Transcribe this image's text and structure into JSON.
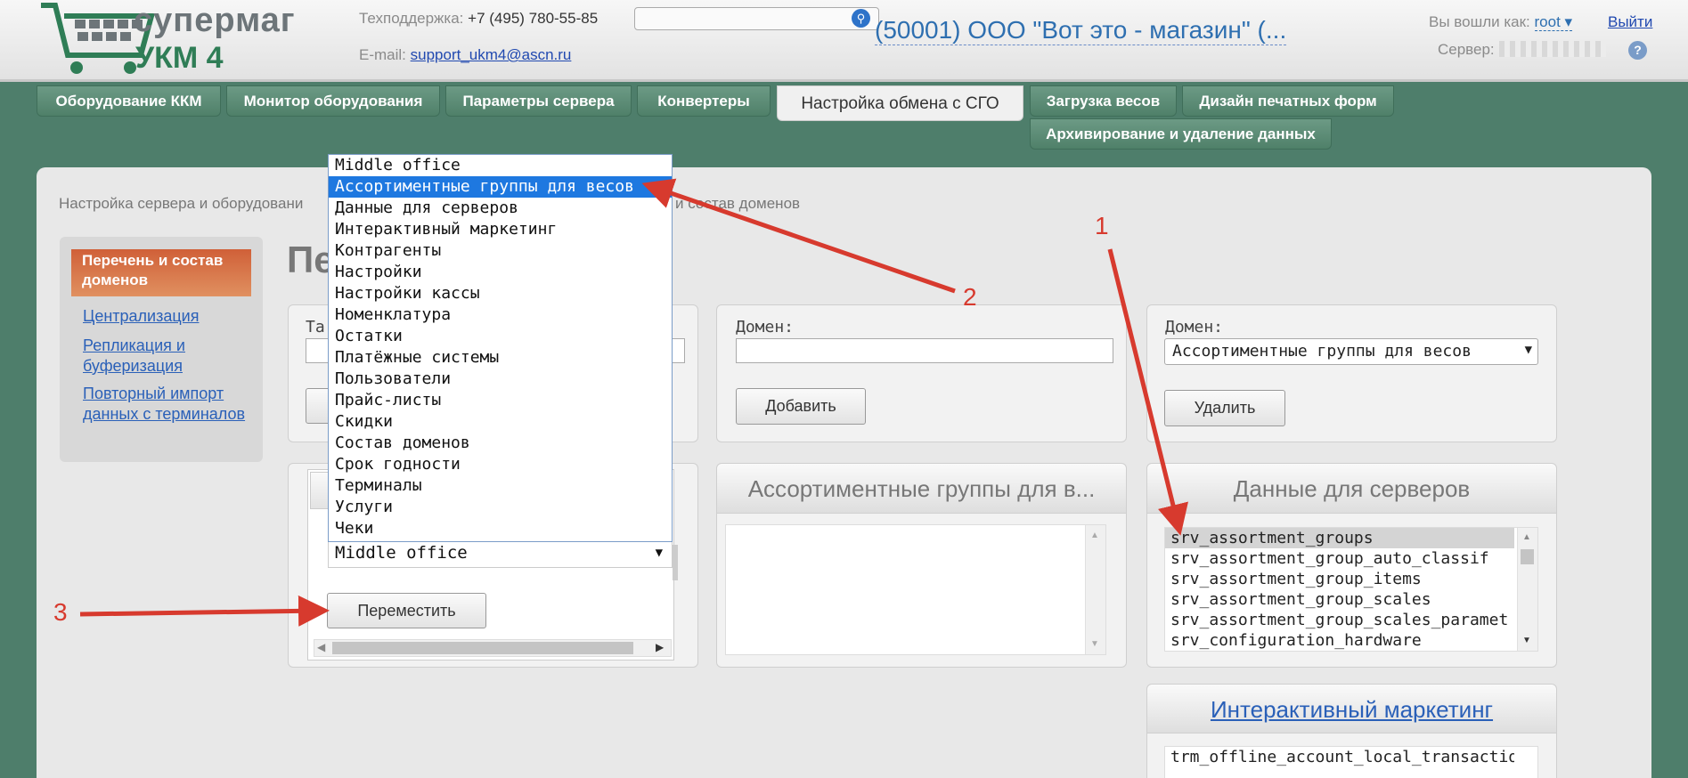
{
  "header": {
    "logo_line1": "супермаг",
    "logo_line2": "УКМ 4",
    "support_label": "Техподдержка:",
    "support_phone": "+7 (495) 780-55-85",
    "email_label": "E-mail:",
    "email": "support_ukm4@ascn.ru",
    "shop_title": "(50001) ООО \"Вот это - магазин\" (...",
    "logged_as_label": "Вы вошли как:",
    "user": "root ▾",
    "logout": "Выйти",
    "server_label": "Сервер:",
    "search_icon": "search-icon",
    "help_icon": "?"
  },
  "tabs": [
    "Оборудование ККМ",
    "Монитор оборудования",
    "Параметры сервера",
    "Конвертеры",
    "Настройка обмена с СГО",
    "Загрузка весов",
    "Дизайн печатных форм",
    "Архивирование и удаление данных"
  ],
  "breadcrumb": {
    "left": "Настройка сервера и оборудовани",
    "right": "и состав доменов"
  },
  "sidebar": {
    "active": "Перечень и состав доменов",
    "links": [
      "Централизация",
      "Репликация и буферизация",
      "Повторный импорт данных с терминалов"
    ]
  },
  "page_title": "Пе",
  "left_box": {
    "label": "Та"
  },
  "middle_box": {
    "domain_label": "Домен:",
    "add_button": "Добавить",
    "list_header": "Ассортиментные группы для в..."
  },
  "right_box": {
    "domain_label": "Домен:",
    "domain_value": "Ассортиментные группы для весов",
    "delete_button": "Удалить",
    "list_header": "Данные для серверов",
    "items": [
      "srv_assortment_groups",
      "srv_assortment_group_auto_classif",
      "srv_assortment_group_items",
      "srv_assortment_group_scales",
      "srv_assortment_group_scales_paramet",
      "srv_configuration_hardware"
    ]
  },
  "bottom_box": {
    "header": "Интерактивный маркетинг",
    "items": [
      "trm_offline_account_local_transaction"
    ]
  },
  "move_form": {
    "select_value": "Middle office",
    "move_button": "Переместить"
  },
  "dropdown": {
    "options": [
      "Middle office",
      "Ассортиментные группы для весов",
      "Данные для серверов",
      "Интерактивный маркетинг",
      "Контрагенты",
      "Настройки",
      "Настройки кассы",
      "Номенклатура",
      "Остатки",
      "Платёжные системы",
      "Пользователи",
      "Прайс-листы",
      "Скидки",
      "Состав доменов",
      "Срок годности",
      "Терминалы",
      "Услуги",
      "Чеки"
    ],
    "highlighted_index": 1
  },
  "annotations": {
    "a1": "1",
    "a2": "2",
    "a3": "3"
  },
  "colors": {
    "accent": "#d73a2e",
    "link": "#2e6fb0",
    "tab": "#5a8a74"
  }
}
